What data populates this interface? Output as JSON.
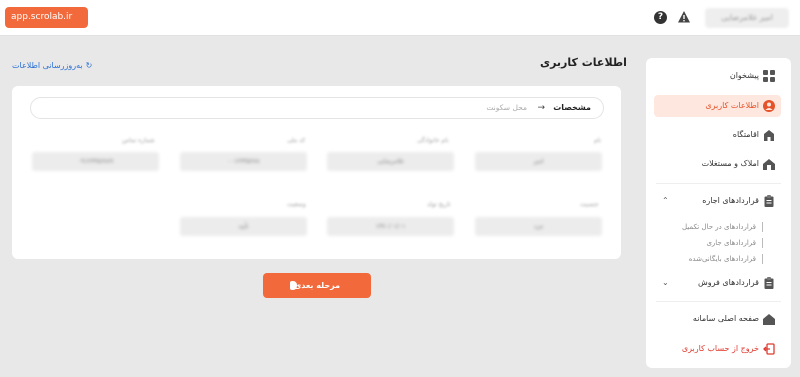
{
  "header": {
    "brand_label": "app.scrolab.ir",
    "help_glyph": "?",
    "user_name": "امیر غلامرضایی"
  },
  "page": {
    "title": "اطلاعات کاربری",
    "refresh_label": "به‌روزرسانی اطلاعات"
  },
  "tabs": {
    "active": "مشخصات",
    "arrow": "→",
    "next": "محل سکونت"
  },
  "fields": [
    {
      "label": "نام",
      "value": "امیر"
    },
    {
      "label": "نام خانوادگی",
      "value": "غلامرضایی"
    },
    {
      "label": "کد ملی",
      "value": "۰۰۱۲۳۴۵۶۷۸"
    },
    {
      "label": "شماره تماس",
      "value": "۰۹۱۲۳۴۵۶۷۸۹"
    },
    {
      "label": "جنسیت",
      "value": "مرد"
    },
    {
      "label": "تاریخ تولد",
      "value": "۱۳۷۰/۰۱/۰۱"
    },
    {
      "label": "وضعیت",
      "value": "تأیید"
    }
  ],
  "next_button": {
    "label": "مرحله بعدی"
  },
  "sidebar": {
    "items": [
      {
        "label": "پیشخوان",
        "icon": "dashboard-icon"
      },
      {
        "label": "اطلاعات کاربری",
        "icon": "user-icon"
      },
      {
        "label": "اقامتگاه",
        "icon": "building-icon"
      },
      {
        "label": "املاک و مستغلات",
        "icon": "house-icon"
      }
    ],
    "rent_contracts": {
      "label": "قراردادهای اجاره",
      "chevron": "⌃",
      "subitems": [
        "قراردادهای در حال تکمیل",
        "قراردادهای جاری",
        "قراردادهای بایگانی‌شده"
      ]
    },
    "sale_contracts": {
      "label": "قراردادهای فروش",
      "chevron": "⌄"
    },
    "home": {
      "label": "صفحه اصلی سامانه"
    },
    "logout": {
      "label": "خروج از حساب کاربری"
    }
  },
  "colors": {
    "accent": "#f26a3c",
    "link": "#2a6fd6",
    "logout": "#e03a2f"
  }
}
